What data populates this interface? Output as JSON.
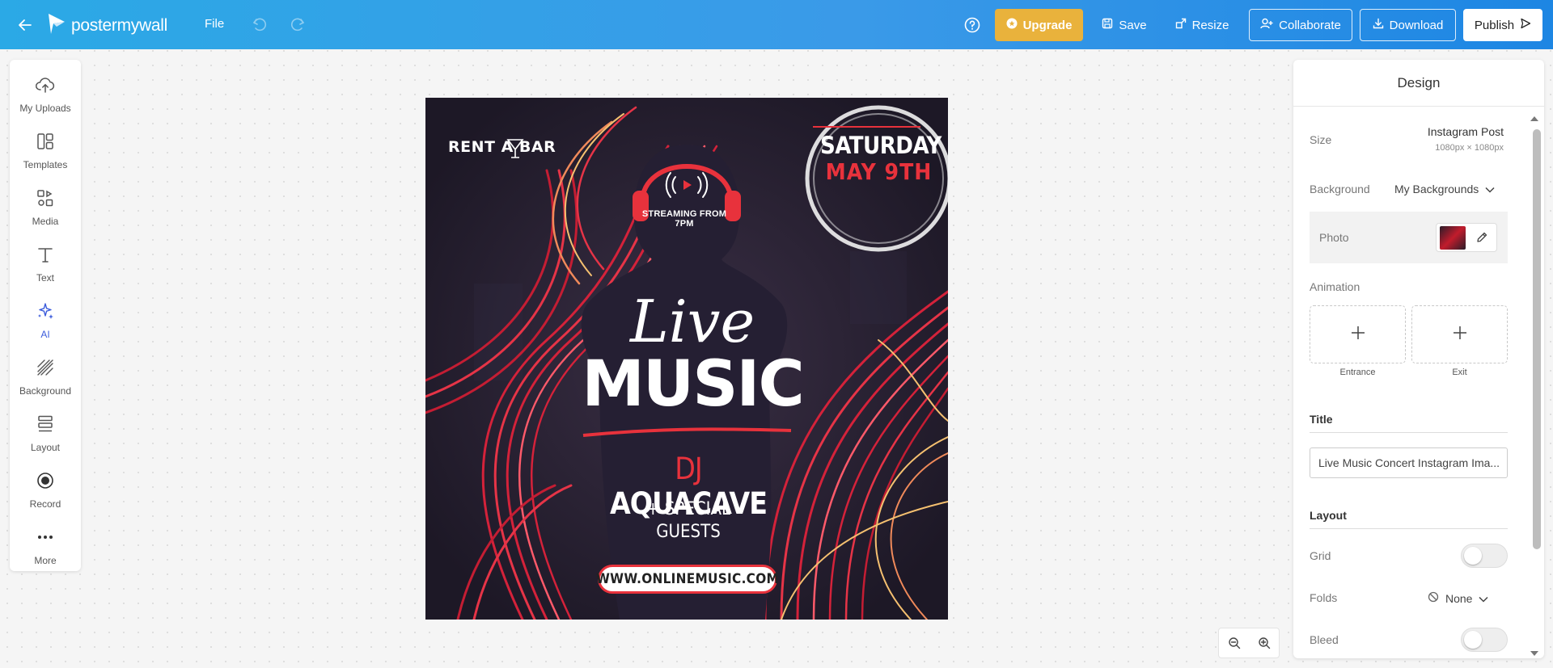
{
  "topbar": {
    "logo_text": "postermywall",
    "file_label": "File",
    "upgrade_label": "Upgrade",
    "save_label": "Save",
    "resize_label": "Resize",
    "collaborate_label": "Collaborate",
    "download_label": "Download",
    "publish_label": "Publish"
  },
  "left_tools": [
    {
      "label": "My Uploads",
      "icon": "upload-cloud-icon"
    },
    {
      "label": "Templates",
      "icon": "templates-icon"
    },
    {
      "label": "Media",
      "icon": "media-icon"
    },
    {
      "label": "Text",
      "icon": "text-icon"
    },
    {
      "label": "AI",
      "icon": "ai-sparkle-icon"
    },
    {
      "label": "Background",
      "icon": "background-icon"
    },
    {
      "label": "Layout",
      "icon": "layout-icon"
    },
    {
      "label": "Record",
      "icon": "record-icon"
    },
    {
      "label": "More",
      "icon": "more-dots-icon"
    }
  ],
  "poster": {
    "brand": "RENT A BAR",
    "day": "SATURDAY",
    "date": "MAY 9TH",
    "streaming": "STREAMING FROM 7PM",
    "live": "Live",
    "music": "MUSIC",
    "dj_prefix": "DJ",
    "dj_name": "AQUACAVE",
    "guests_line1": "+ SPECIAL",
    "guests_line2": "GUESTS",
    "url": "WWW.ONLINEMUSIC.COM"
  },
  "right_panel": {
    "header": "Design",
    "size_label": "Size",
    "size_name": "Instagram Post",
    "size_dims": "1080px × 1080px",
    "background_label": "Background",
    "background_value": "My Backgrounds",
    "photo_label": "Photo",
    "animation_label": "Animation",
    "entrance_label": "Entrance",
    "exit_label": "Exit",
    "title_section": "Title",
    "title_value": "Live Music Concert  Instagram Ima...",
    "layout_section": "Layout",
    "grid_label": "Grid",
    "folds_label": "Folds",
    "folds_value": "None",
    "bleed_label": "Bleed",
    "grid_on": false,
    "bleed_on": false
  },
  "colors": {
    "topbar_gradient_start": "#2ba9e6",
    "topbar_gradient_end": "#1d86e3",
    "upgrade_bg": "#e9b23c",
    "poster_accent": "#e8323c",
    "poster_bg": "#231f2f",
    "ai_accent": "#3b5bdb"
  }
}
